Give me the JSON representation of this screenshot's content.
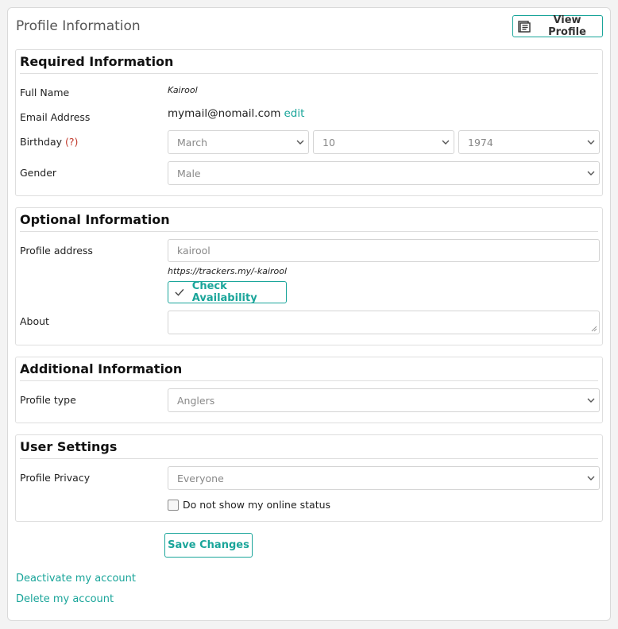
{
  "header": {
    "title": "Profile Information",
    "view_profile_label": "View Profile"
  },
  "required": {
    "title": "Required Information",
    "full_name_label": "Full Name",
    "full_name_value": "Kairool",
    "email_label": "Email Address",
    "email_value": "mymail@nomail.com",
    "email_edit": "edit",
    "birthday_label": "Birthday",
    "birthday_help": "(?)",
    "birthday_month": "March",
    "birthday_day": "10",
    "birthday_year": "1974",
    "gender_label": "Gender",
    "gender_value": "Male"
  },
  "optional": {
    "title": "Optional Information",
    "profile_address_label": "Profile address",
    "profile_address_placeholder": "kairool",
    "profile_url": "https://trackers.my/-kairool",
    "check_label": "Check Availability",
    "about_label": "About"
  },
  "additional": {
    "title": "Additional Information",
    "profile_type_label": "Profile type",
    "profile_type_value": "Anglers"
  },
  "settings": {
    "title": "User Settings",
    "privacy_label": "Profile Privacy",
    "privacy_value": "Everyone",
    "online_status_label": "Do not show my online status"
  },
  "actions": {
    "save_label": "Save Changes",
    "deactivate_label": "Deactivate my account",
    "delete_label": "Delete my account"
  },
  "colors": {
    "accent": "#1aa59a",
    "help": "#c0392b"
  }
}
